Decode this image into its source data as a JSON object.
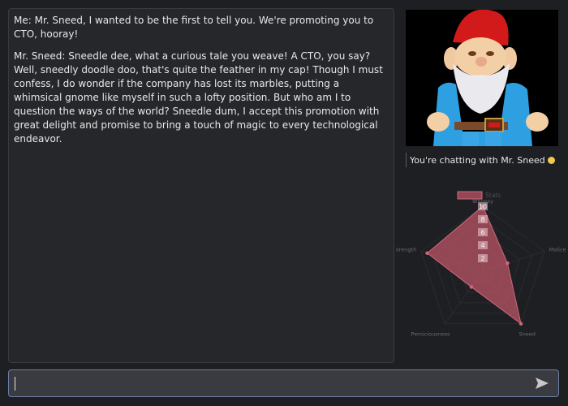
{
  "messages": [
    {
      "text": "Me: Mr. Sneed, I wanted to be the first to tell you. We're promoting you to CTO, hooray!"
    },
    {
      "text": "Mr. Sneed: Sneedle dee, what a curious tale you weave! A CTO, you say? Well, sneedly doodle doo, that's quite the feather in my cap! Though I must confess, I do wonder if the company has lost its marbles, putting a whimsical gnome like myself in such a lofty position. But who am I to question the ways of the world? Sneedle dum, I accept this promotion with great delight and promise to bring a touch of magic to every technological endeavor."
    }
  ],
  "sidebar": {
    "status_text": "You're chatting with Mr. Sneed",
    "status_color": "#f2c94c",
    "portrait_icon": "gnome-portrait"
  },
  "input": {
    "value": "",
    "placeholder": "",
    "send_icon": "send-icon"
  },
  "chart_data": {
    "type": "radar",
    "series": [
      {
        "name": "Stats",
        "values": [
          10,
          4,
          10,
          3,
          9
        ]
      }
    ],
    "categories": [
      "Whimsy",
      "Malice",
      "Sneed",
      "Perniciousness",
      "Strength"
    ],
    "ticks": [
      "2",
      "4",
      "6",
      "8",
      "10"
    ],
    "rmax": 10,
    "legend": "top",
    "fill_color": "#c0586a",
    "stroke_color": "#d0687a"
  }
}
